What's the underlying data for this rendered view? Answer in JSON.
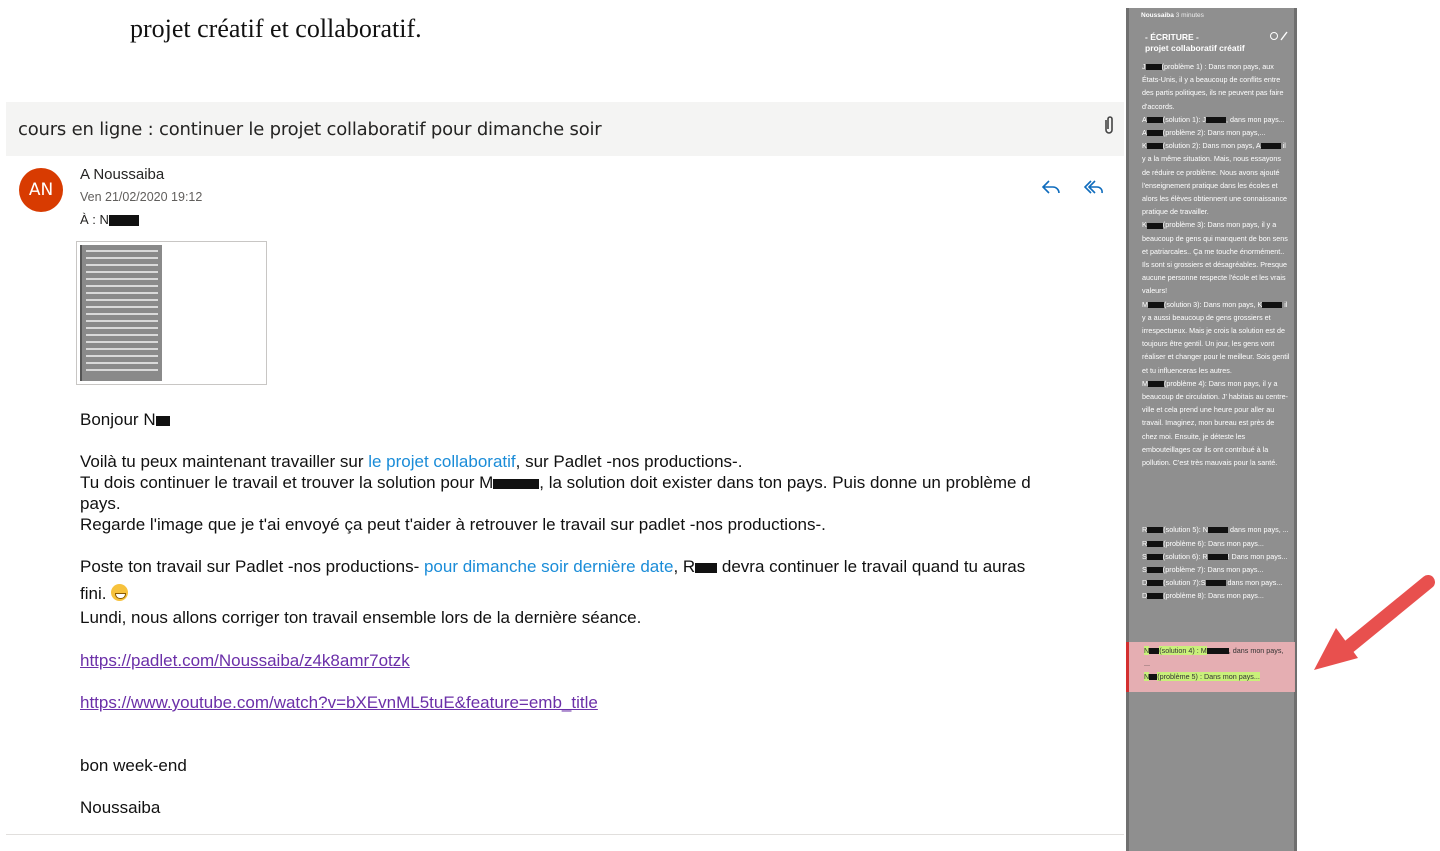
{
  "document": {
    "caption_line": "projet créatif et collaboratif."
  },
  "email": {
    "subject": "cours en ligne : continuer le projet collaboratif pour dimanche soir",
    "avatar_initials": "AN",
    "avatar_color": "#d83b01",
    "sender": "A Noussaiba",
    "date": "Ven 21/02/2020 19:12",
    "to_label": "À :",
    "to_visible": "N",
    "greeting": "Bonjour N",
    "p1_before": "Voilà tu peux maintenant travailler sur ",
    "p1_link": "le projet collaboratif",
    "p1_after": ", sur Padlet -nos productions-.",
    "p2_before": "Tu dois continuer le travail et trouver la solution pour M",
    "p2_after": ", la solution doit exister dans ton pays. Puis donne un problème d",
    "p3": "pays.",
    "p4": "Regarde l'image que je t'ai envoyé ça peut t'aider à retrouver le travail sur padlet -nos productions-.",
    "p5_before": "Poste ton travail sur Padlet -nos productions- ",
    "p5_link": "pour dimanche soir dernière date",
    "p5_mid": ", R",
    "p5_after": " devra continuer le travail quand tu auras",
    "p6": "fini.",
    "p7": "Lundi, nous allons corriger ton travail ensemble lors de la dernière séance.",
    "link1": "https://padlet.com/Noussaiba/z4k8amr7otzk",
    "link2": "https://www.youtube.com/watch?v=bXEvnML5tuE&feature=emb_title",
    "closing": "bon week-end",
    "signature": "Noussaiba",
    "link_color": "#1a8cd8"
  },
  "padlet": {
    "author": "Noussaiba",
    "time": "3 minutes",
    "title": "- ÉCRITURE -",
    "subtitle": "projet collaboratif créatif",
    "lines": [
      [
        "J",
        "(problème 1) : Dans mon pays, aux États-Unis, il y a beaucoup de conflits entre des partis politiques, ils ne peuvent pas faire d'accords."
      ],
      [
        "A",
        "(solution 1): J",
        ", dans mon pays..."
      ],
      [
        "A",
        "(problème 2): Dans mon pays,..."
      ],
      [
        "K",
        "(solution 2): Dans mon pays, A",
        " il y a la même situation. Mais, nous essayons de réduire ce problème. Nous avons ajouté l'enseignement pratique dans les écoles et alors les élèves obtiennent une connaissance pratique de travailler."
      ],
      [
        "K",
        "(problème 3): Dans mon pays, il y a beaucoup de gens qui manquent de bon sens et patriarcales.. Ça me touche énormément.. Ils sont si grossiers et désagréables. Presque aucune personne respecte l'école et les vrais valeurs!"
      ],
      [
        "M",
        "(solution 3): Dans mon pays, K",
        " il y a aussi beaucoup de gens grossiers et irrespectueux. Mais je crois la solution est de toujours être gentil. Un jour, les gens vont réaliser et changer pour le meilleur. Sois gentil et tu influenceras les autres."
      ],
      [
        "M",
        "(problème 4): Dans mon pays, il y a beaucoup de circulation. J' habitais au centre-ville et cela prend une heure pour aller au travail. Imaginez, mon bureau est près de chez moi. Ensuite, je déteste les embouteillages car ils ont contribué à la pollution. C'est très mauvais pour la santé."
      ]
    ],
    "highlight_1a": "N",
    "highlight_1b": "(solution 4) : M",
    "highlight_1c": ", dans mon pays, ...",
    "highlight_2a": "N",
    "highlight_2b": "(problème 5) : Dans mon pays...",
    "after": [
      [
        "R",
        "(solution 5): N",
        " dans mon pays, ..."
      ],
      [
        "R",
        "(problème 6): Dans mon pays..."
      ],
      [
        "S",
        "(solution 6): R",
        "! Dans mon pays..."
      ],
      [
        "S",
        "(problème 7): Dans mon pays..."
      ],
      [
        "D",
        "(solution 7):S",
        " dans mon pays..."
      ],
      [
        "D",
        "(problème 8): Dans mon pays..."
      ]
    ],
    "highlight_color": "#f4b4b8",
    "arrow_color": "#e8504e"
  }
}
